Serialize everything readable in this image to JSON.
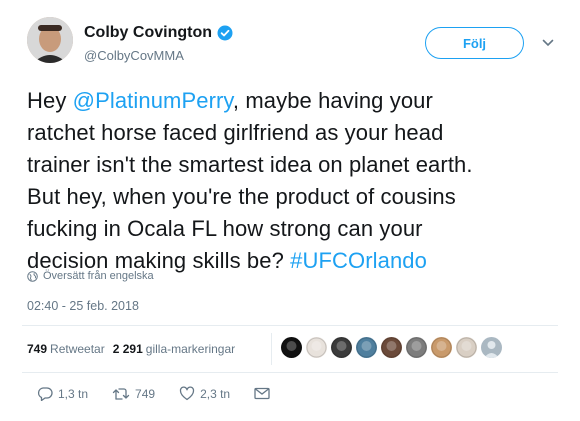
{
  "author": {
    "display_name": "Colby Covington",
    "handle": "@ColbyCovMMA",
    "verified": true,
    "avatar_icon": "avatar-photo"
  },
  "follow_label": "Följ",
  "tweet": {
    "lines": [
      [
        {
          "text": "Hey ",
          "link": false
        },
        {
          "text": "@PlatinumPerry",
          "link": true
        },
        {
          "text": ", maybe having your",
          "link": false
        }
      ],
      [
        {
          "text": "ratchet horse faced girlfriend as your head",
          "link": false
        }
      ],
      [
        {
          "text": "trainer isn't the smartest idea on planet earth.",
          "link": false
        }
      ],
      [
        {
          "text": "But hey, when you're the product of cousins",
          "link": false
        }
      ],
      [
        {
          "text": "fucking in Ocala FL how strong can your",
          "link": false
        }
      ],
      [
        {
          "text": "decision making skills be? ",
          "link": false
        },
        {
          "text": "#UFCOrlando",
          "link": true
        }
      ]
    ]
  },
  "translate_label": "Översätt från engelska",
  "timestamp": "02:40 - 25 feb. 2018",
  "stats": {
    "retweets_count": "749",
    "retweets_label": "Retweetar",
    "likes_count": "2 291",
    "likes_label": "gilla-markeringar"
  },
  "liker_avatars": [
    "#111111",
    "#e8e2dc",
    "#3b3b3b",
    "#4f7f9e",
    "#6b4a3a",
    "#7d7d7d",
    "#c99a6b",
    "#d9cfc4",
    "#aab8c2"
  ],
  "actions": {
    "reply_count": "1,3 tn",
    "retweet_count": "749",
    "like_count": "2,3 tn"
  },
  "colors": {
    "accent": "#1da1f2",
    "secondary_text": "#657786",
    "divider": "#e6ecf0"
  }
}
